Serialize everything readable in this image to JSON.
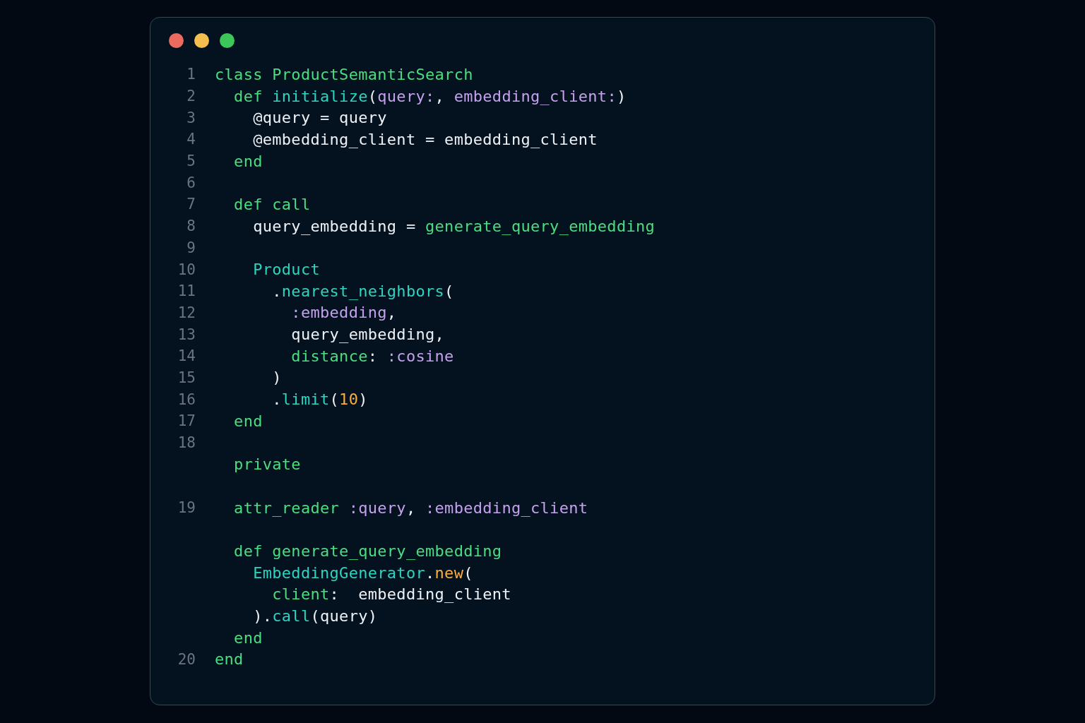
{
  "window": {
    "controls": [
      {
        "color": "#ec6a5e"
      },
      {
        "color": "#f4bf4f"
      },
      {
        "color": "#3dc65a"
      }
    ]
  },
  "code_sections": [
    {
      "lines": [
        {
          "number": "1",
          "tokens": [
            {
              "text": "class ProductSemanticSearch",
              "kind": "keyword"
            }
          ]
        },
        {
          "number": "2",
          "tokens": [
            {
              "text": "  def ",
              "kind": "keyword"
            },
            {
              "text": "initialize",
              "kind": "method"
            },
            {
              "text": "(",
              "kind": "plain"
            },
            {
              "text": "query:",
              "kind": "symbol"
            },
            {
              "text": ", ",
              "kind": "plain"
            },
            {
              "text": "embedding_client:",
              "kind": "symbol"
            },
            {
              "text": ")",
              "kind": "plain"
            }
          ]
        },
        {
          "number": "3",
          "tokens": [
            {
              "text": "    @query = query",
              "kind": "plain"
            }
          ]
        },
        {
          "number": "4",
          "tokens": [
            {
              "text": "    @embedding_client = embedding_client",
              "kind": "plain"
            }
          ]
        },
        {
          "number": "5",
          "tokens": [
            {
              "text": "  end",
              "kind": "keyword"
            }
          ]
        },
        {
          "number": "6"
        },
        {
          "number": "7",
          "tokens": [
            {
              "text": "  def call",
              "kind": "keyword"
            }
          ]
        },
        {
          "number": "8",
          "tokens": [
            {
              "text": "    query_embedding = ",
              "kind": "plain"
            },
            {
              "text": "generate_query_embedding",
              "kind": "keyword"
            }
          ]
        },
        {
          "number": "9"
        },
        {
          "number": "10",
          "tokens": [
            {
              "text": "    Product",
              "kind": "method"
            }
          ]
        },
        {
          "number": "11",
          "tokens": [
            {
              "text": "      .",
              "kind": "plain"
            },
            {
              "text": "nearest_neighbors",
              "kind": "method"
            },
            {
              "text": "(",
              "kind": "plain"
            }
          ]
        },
        {
          "number": "12",
          "tokens": [
            {
              "text": "        :embedding",
              "kind": "symbol"
            },
            {
              "text": ",",
              "kind": "plain"
            }
          ]
        },
        {
          "number": "13",
          "tokens": [
            {
              "text": "        query_embedding,",
              "kind": "plain"
            }
          ]
        },
        {
          "number": "14",
          "tokens": [
            {
              "text": "        distance",
              "kind": "keyword"
            },
            {
              "text": ": ",
              "kind": "plain"
            },
            {
              "text": ":cosine",
              "kind": "symbol"
            }
          ]
        },
        {
          "number": "15",
          "tokens": [
            {
              "text": "      )",
              "kind": "plain"
            }
          ]
        },
        {
          "number": "16",
          "tokens": [
            {
              "text": "      .",
              "kind": "plain"
            },
            {
              "text": "limit",
              "kind": "method"
            },
            {
              "text": "(",
              "kind": "plain"
            },
            {
              "text": "10",
              "kind": "number"
            },
            {
              "text": ")",
              "kind": "plain"
            }
          ]
        },
        {
          "number": "17",
          "tokens": [
            {
              "text": "  end",
              "kind": "keyword"
            }
          ]
        },
        {
          "number": "18"
        },
        {
          "tokens": [
            {
              "text": "  private",
              "kind": "keyword"
            }
          ]
        }
      ]
    },
    {
      "lines": [
        {
          "number": "19",
          "tokens": [
            {
              "text": "  attr_reader ",
              "kind": "keyword"
            },
            {
              "text": ":query",
              "kind": "symbol"
            },
            {
              "text": ", ",
              "kind": "plain"
            },
            {
              "text": ":embedding_client",
              "kind": "symbol"
            }
          ]
        }
      ]
    },
    {
      "lines": [
        {
          "tokens": [
            {
              "text": "  def generate_query_embedding",
              "kind": "keyword"
            }
          ]
        },
        {
          "tokens": [
            {
              "text": "    EmbeddingGenerator",
              "kind": "method"
            },
            {
              "text": ".",
              "kind": "plain"
            },
            {
              "text": "new",
              "kind": "number"
            },
            {
              "text": "(",
              "kind": "plain"
            }
          ]
        },
        {
          "tokens": [
            {
              "text": "      client",
              "kind": "keyword"
            },
            {
              "text": ":  embedding_client",
              "kind": "plain"
            }
          ]
        },
        {
          "tokens": [
            {
              "text": "    ).",
              "kind": "plain"
            },
            {
              "text": "call",
              "kind": "method"
            },
            {
              "text": "(query)",
              "kind": "plain"
            }
          ]
        },
        {
          "tokens": [
            {
              "text": "  end",
              "kind": "keyword"
            }
          ]
        },
        {
          "number": "20",
          "tokens": [
            {
              "text": "end",
              "kind": "keyword"
            }
          ]
        }
      ]
    }
  ]
}
